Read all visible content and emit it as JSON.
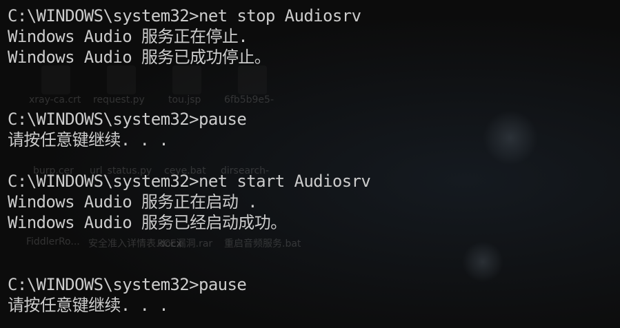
{
  "terminal": {
    "lines": [
      "C:\\WINDOWS\\system32>net stop Audiosrv",
      "Windows Audio 服务正在停止.",
      "Windows Audio 服务已成功停止。",
      "C:\\WINDOWS\\system32>pause",
      "请按任意键继续. . .",
      "C:\\WINDOWS\\system32>net start Audiosrv",
      "Windows Audio 服务正在启动 .",
      "Windows Audio 服务已经启动成功。",
      "C:\\WINDOWS\\system32>pause",
      "请按任意键继续. . ."
    ]
  },
  "desktop": {
    "icons": [
      "xray-ca.crt",
      "request.py",
      "tou.jsp",
      "6fb5b9e5-",
      "burp.cer",
      "url_status.py",
      "ceye.bat",
      "dirsearch-",
      "FiddlerRo...",
      "安全准入详情表.docx",
      "RCE漏洞.rar",
      "重启音频服务.bat"
    ]
  },
  "colors": {
    "background": "#0c0c0c",
    "text": "#cccccc"
  }
}
